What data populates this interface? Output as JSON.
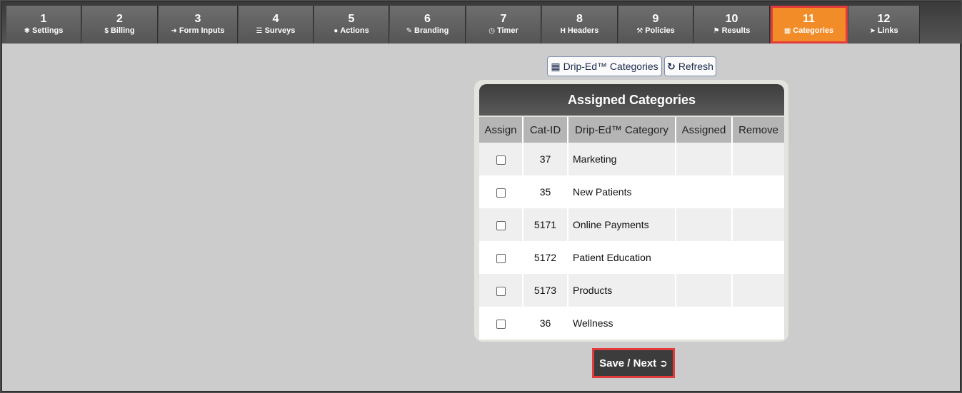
{
  "tabs": [
    {
      "num": "1",
      "label": "Settings",
      "icon": "gear-icon",
      "glyph": "✱"
    },
    {
      "num": "2",
      "label": "Billing",
      "icon": "dollar-icon",
      "glyph": "$"
    },
    {
      "num": "3",
      "label": "Form Inputs",
      "icon": "sign-in-icon",
      "glyph": "➜"
    },
    {
      "num": "4",
      "label": "Surveys",
      "icon": "list-icon",
      "glyph": "☰"
    },
    {
      "num": "5",
      "label": "Actions",
      "icon": "user-icon",
      "glyph": "●"
    },
    {
      "num": "6",
      "label": "Branding",
      "icon": "brush-icon",
      "glyph": "✎"
    },
    {
      "num": "7",
      "label": "Timer",
      "icon": "clock-icon",
      "glyph": "◷"
    },
    {
      "num": "8",
      "label": "Headers",
      "icon": "header-icon",
      "glyph": "H"
    },
    {
      "num": "9",
      "label": "Policies",
      "icon": "gavel-icon",
      "glyph": "⚒"
    },
    {
      "num": "10",
      "label": "Results",
      "icon": "flag-icon",
      "glyph": "⚑"
    },
    {
      "num": "11",
      "label": "Categories",
      "icon": "cubes-icon",
      "glyph": "▦"
    },
    {
      "num": "12",
      "label": "Links",
      "icon": "pointer-icon",
      "glyph": "➤"
    }
  ],
  "active_tab": "11",
  "toolbar": {
    "categories_label": "Drip-Ed™ Categories",
    "refresh_label": "Refresh"
  },
  "panel": {
    "title": "Assigned Categories",
    "columns": [
      "Assign",
      "Cat-ID",
      "Drip-Ed™ Category",
      "Assigned",
      "Remove"
    ],
    "rows": [
      {
        "cat_id": "37",
        "category": "Marketing",
        "assigned": "",
        "remove": ""
      },
      {
        "cat_id": "35",
        "category": "New Patients",
        "assigned": "",
        "remove": ""
      },
      {
        "cat_id": "5171",
        "category": "Online Payments",
        "assigned": "",
        "remove": ""
      },
      {
        "cat_id": "5172",
        "category": "Patient Education",
        "assigned": "",
        "remove": ""
      },
      {
        "cat_id": "5173",
        "category": "Products",
        "assigned": "",
        "remove": ""
      },
      {
        "cat_id": "36",
        "category": "Wellness",
        "assigned": "",
        "remove": ""
      }
    ]
  },
  "save_label": "Save / Next",
  "colors": {
    "active_tab": "#f28c28",
    "highlight": "#e23b3b",
    "tab_bg": "#636363",
    "page_bg": "#cccccc"
  }
}
